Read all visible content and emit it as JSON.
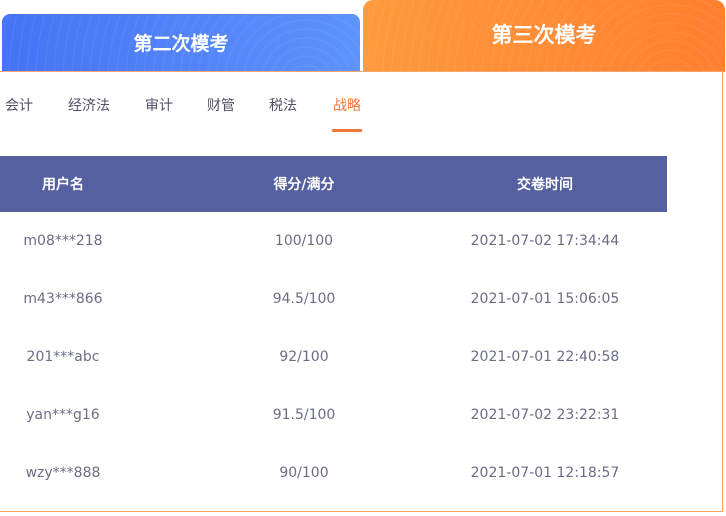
{
  "exam_tabs": [
    {
      "label": "第二次模考"
    },
    {
      "label": "第三次模考"
    }
  ],
  "subjects": [
    "会计",
    "经济法",
    "审计",
    "财管",
    "税法",
    "战略"
  ],
  "active_subject": "战略",
  "table": {
    "headers": [
      "用户名",
      "得分/满分",
      "交卷时间"
    ],
    "rows": [
      {
        "user": "m08***218",
        "score": "100/100",
        "time": "2021-07-02 17:34:44"
      },
      {
        "user": "m43***866",
        "score": "94.5/100",
        "time": "2021-07-01 15:06:05"
      },
      {
        "user": "201***abc",
        "score": "92/100",
        "time": "2021-07-01 22:40:58"
      },
      {
        "user": "yan***g16",
        "score": "91.5/100",
        "time": "2021-07-02 23:22:31"
      },
      {
        "user": "wzy***888",
        "score": "90/100",
        "time": "2021-07-01 12:18:57"
      }
    ]
  },
  "colors": {
    "tab_blue": "#4f7ff7",
    "tab_orange": "#ff8a35",
    "accent": "#f2763a",
    "header_bg": "#5460a0"
  }
}
